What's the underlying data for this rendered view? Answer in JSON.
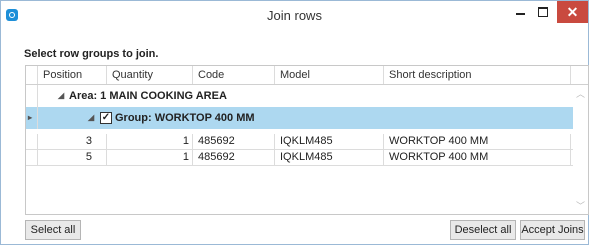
{
  "window": {
    "title": "Join rows",
    "close_glyph": "✕"
  },
  "prompt": "Select row groups to join.",
  "columns": [
    "Position",
    "Quantity",
    "Code",
    "Model",
    "Short description"
  ],
  "area_label": "Area: 1 MAIN COOKING AREA",
  "group_label": "Group: WORKTOP 400 MM",
  "group_checked": true,
  "rows": [
    {
      "position": "3",
      "quantity": "1",
      "code": "485692",
      "model": "IQKLM485",
      "description": "WORKTOP 400 MM"
    },
    {
      "position": "5",
      "quantity": "1",
      "code": "485692",
      "model": "IQKLM485",
      "description": "WORKTOP 400 MM"
    }
  ],
  "buttons": {
    "select_all": "Select all",
    "deselect_all": "Deselect all",
    "accept_joins": "Accept Joins"
  },
  "icons": {
    "expand": "triangle-down-icon",
    "row-pointer": "triangle-right-icon",
    "check": "checkmark-icon"
  },
  "colors": {
    "selection": "#add8f0",
    "close": "#c94a3f",
    "app_icon": "#1e8fd8"
  }
}
